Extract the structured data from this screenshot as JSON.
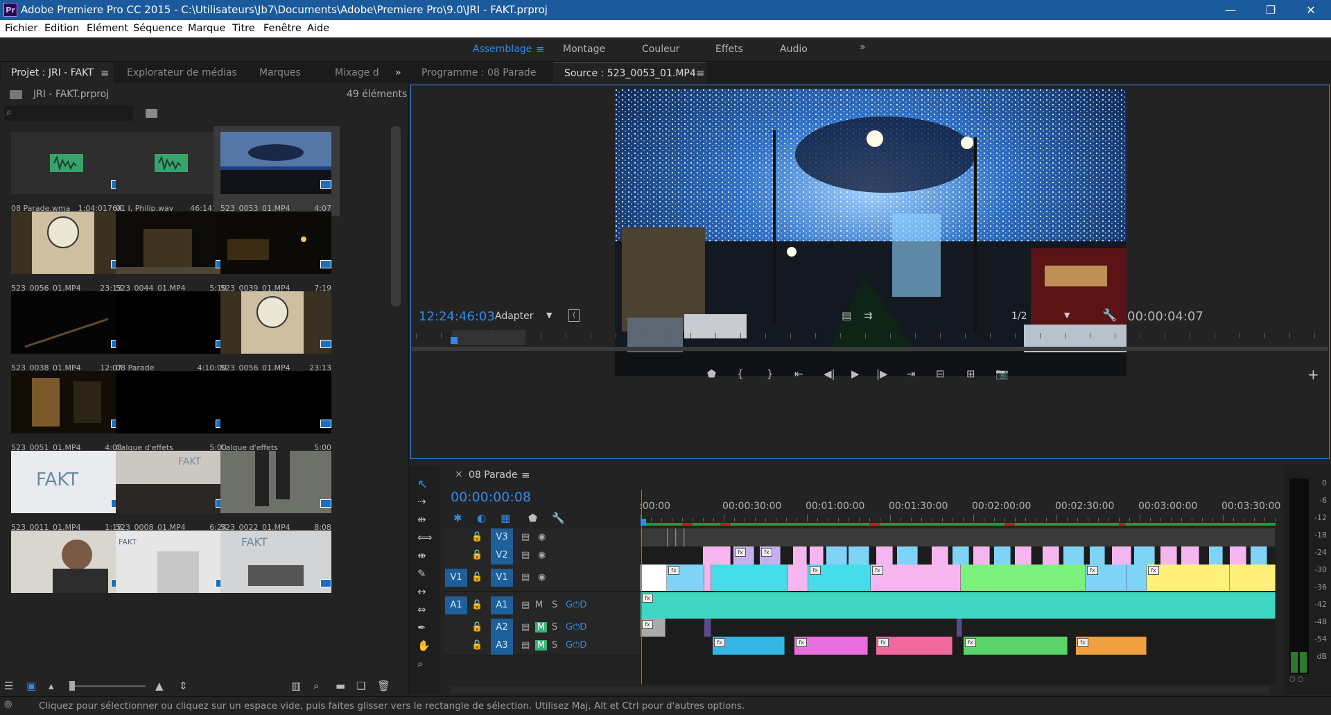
{
  "window": {
    "title": "Adobe Premiere Pro CC 2015 - C:\\Utilisateurs\\Jb7\\Documents\\Adobe\\Premiere Pro\\9.0\\JRI - FAKT.prproj",
    "app_badge": "Pr",
    "minimize": "—",
    "maximize": "❐",
    "close": "✕"
  },
  "menu": [
    "Fichier",
    "Edition",
    "Elément",
    "Séquence",
    "Marque",
    "Titre",
    "Fenêtre",
    "Aide"
  ],
  "workspaces": {
    "items": [
      "Assemblage",
      "Montage",
      "Couleur",
      "Effets",
      "Audio"
    ],
    "active": "Assemblage",
    "more": "»"
  },
  "project": {
    "tabs": [
      "Projet : JRI - FAKT",
      "Explorateur de médias",
      "Marques",
      "Mixage d"
    ],
    "file": "JRI - FAKT.prproj",
    "count": "49 éléments",
    "items": [
      {
        "name": "08 Parade.wma",
        "duration": "1:04:01764",
        "kind": "audio"
      },
      {
        "name": "01 I, Philip.wav",
        "duration": "46:14112",
        "kind": "audio"
      },
      {
        "name": "523_0053_01.MP4",
        "duration": "4:07",
        "kind": "lights"
      },
      {
        "name": "523_0056_01.MP4",
        "duration": "23:13",
        "kind": "clock"
      },
      {
        "name": "523_0044_01.MP4",
        "duration": "5:10",
        "kind": "castle"
      },
      {
        "name": "523_0039_01.MP4",
        "duration": "7:19",
        "kind": "night"
      },
      {
        "name": "523_0038_01.MP4",
        "duration": "12:07",
        "kind": "dark"
      },
      {
        "name": "08 Parade",
        "duration": "4:10:00",
        "kind": "black"
      },
      {
        "name": "523_0056_01.MP4",
        "duration": "23:13",
        "kind": "clock"
      },
      {
        "name": "523_0051_01.MP4",
        "duration": "4:08",
        "kind": "window"
      },
      {
        "name": "Calque d'effets",
        "duration": "5:00",
        "kind": "black"
      },
      {
        "name": "Calque d'effets",
        "duration": "5:00",
        "kind": "black"
      },
      {
        "name": "523_0011_01.MP4",
        "duration": "1:18",
        "kind": "fakt"
      },
      {
        "name": "523_0008_01.MP4",
        "duration": "6:24",
        "kind": "fakt2"
      },
      {
        "name": "523_0022_01.MP4",
        "duration": "8:08",
        "kind": "legs"
      },
      {
        "name": "",
        "duration": "",
        "kind": "person"
      },
      {
        "name": "",
        "duration": "",
        "kind": "fakt3"
      },
      {
        "name": "",
        "duration": "",
        "kind": "fakt4"
      }
    ]
  },
  "monitor": {
    "tabs": [
      "Programme : 08 Parade",
      "Source : 523_0053_01.MP4"
    ],
    "timecode": "12:24:46:03",
    "fit": "Adapter",
    "resolution": "1/2",
    "duration": "00:00:04:07",
    "add": "+"
  },
  "timeline": {
    "sequence": "08 Parade",
    "close": "×",
    "timecode": "00:00:00:08",
    "ruler": [
      ":00:00",
      "00:00:30:00",
      "00:01:00:00",
      "00:01:30:00",
      "00:02:00:00",
      "00:02:30:00",
      "00:03:00:00",
      "00:03:30:00"
    ],
    "video_tracks": [
      "V3",
      "V2",
      "V1"
    ],
    "audio_tracks": [
      "A1",
      "A2",
      "A3"
    ],
    "source_v": "V1",
    "source_a": "A1",
    "mute": "M",
    "solo": "S",
    "fx": "fx"
  },
  "meter": {
    "scale": [
      "0",
      "-6",
      "-12",
      "-18",
      "-24",
      "-30",
      "-36",
      "-42",
      "-48",
      "-54",
      "dB"
    ]
  },
  "status": {
    "text": "Cliquez pour sélectionner ou cliquez sur un espace vide, puis faites glisser vers le rectangle de sélection. Utilisez Maj, Alt et Ctrl pour d'autres options."
  },
  "icons": [
    "search-icon",
    "folder-icon",
    "list-view-icon",
    "icon-view-icon",
    "zoom-slider",
    "sort-icon",
    "new-bin-icon",
    "find-icon",
    "new-item-icon",
    "trash-icon",
    "selection-tool-icon",
    "track-select-icon",
    "ripple-edit-icon",
    "rolling-edit-icon",
    "rate-stretch-icon",
    "razor-icon",
    "slip-icon",
    "slide-icon",
    "pen-icon",
    "hand-icon",
    "zoom-icon",
    "wrench-icon",
    "camera-icon",
    "play-icon"
  ]
}
